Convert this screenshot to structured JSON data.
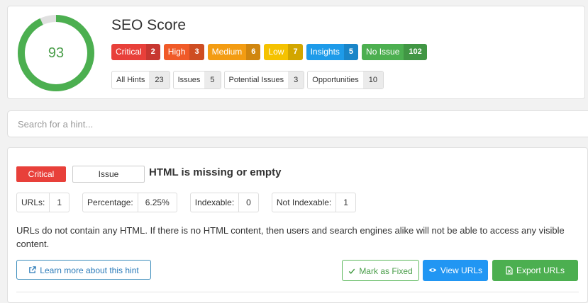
{
  "header": {
    "title": "SEO Score",
    "score": "93",
    "score_fraction": 0.93,
    "gauge_color": "#4caf50",
    "gauge_track_color": "#e0e0e0"
  },
  "severity_badges": [
    {
      "label": "Critical",
      "count": "2",
      "color": "#e8403a"
    },
    {
      "label": "High",
      "count": "3",
      "color": "#f05a28"
    },
    {
      "label": "Medium",
      "count": "6",
      "color": "#f39c12"
    },
    {
      "label": "Low",
      "count": "7",
      "color": "#f5c200"
    },
    {
      "label": "Insights",
      "count": "5",
      "color": "#1e9be9"
    },
    {
      "label": "No Issue",
      "count": "102",
      "color": "#4caf50"
    }
  ],
  "hint_filters": [
    {
      "label": "All Hints",
      "count": "23"
    },
    {
      "label": "Issues",
      "count": "5"
    },
    {
      "label": "Potential Issues",
      "count": "3"
    },
    {
      "label": "Opportunities",
      "count": "10"
    }
  ],
  "search": {
    "placeholder": "Search for a hint..."
  },
  "hint": {
    "severity": "Critical",
    "type": "Issue",
    "title": "HTML is missing or empty",
    "stats": [
      {
        "label": "URLs:",
        "value": "1"
      },
      {
        "label": "Percentage:",
        "value": "6.25%"
      },
      {
        "label": "Indexable:",
        "value": "0"
      },
      {
        "label": "Not Indexable:",
        "value": "1"
      }
    ],
    "description": "URLs do not contain any HTML. If there is no HTML content, then users and search engines alike will not be able to access any visible content.",
    "learn_more": "Learn more about this hint",
    "mark_fixed": "Mark as Fixed",
    "view_urls": "View URLs",
    "export_urls": "Export URLs"
  },
  "icons": {
    "external_link": "external-link-icon",
    "check": "check-icon",
    "eye": "eye-icon",
    "excel": "excel-file-icon"
  }
}
